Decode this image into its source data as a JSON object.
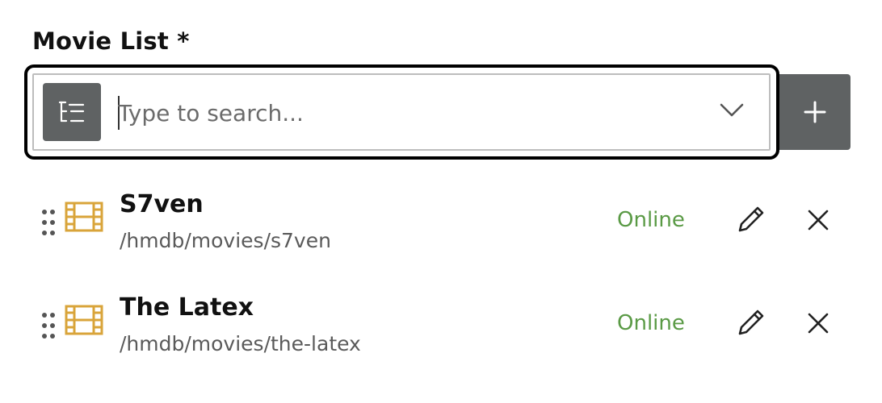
{
  "field": {
    "label": "Movie List *"
  },
  "search": {
    "placeholder": "Type to search...",
    "value": ""
  },
  "icons": {
    "tree_button": "tree-structure-icon",
    "dropdown": "chevron-down-icon",
    "add": "plus-icon",
    "drag": "drag-handle-icon",
    "item": "film-icon",
    "edit": "pencil-icon",
    "remove": "close-icon"
  },
  "colors": {
    "button_bg": "#5f6263",
    "film_icon": "#d9a43a",
    "status_online": "#5a9a45",
    "focus_ring": "#000000"
  },
  "items": [
    {
      "title": "S7ven",
      "path": "/hmdb/movies/s7ven",
      "status": "Online"
    },
    {
      "title": "The Latex",
      "path": "/hmdb/movies/the-latex",
      "status": "Online"
    }
  ]
}
